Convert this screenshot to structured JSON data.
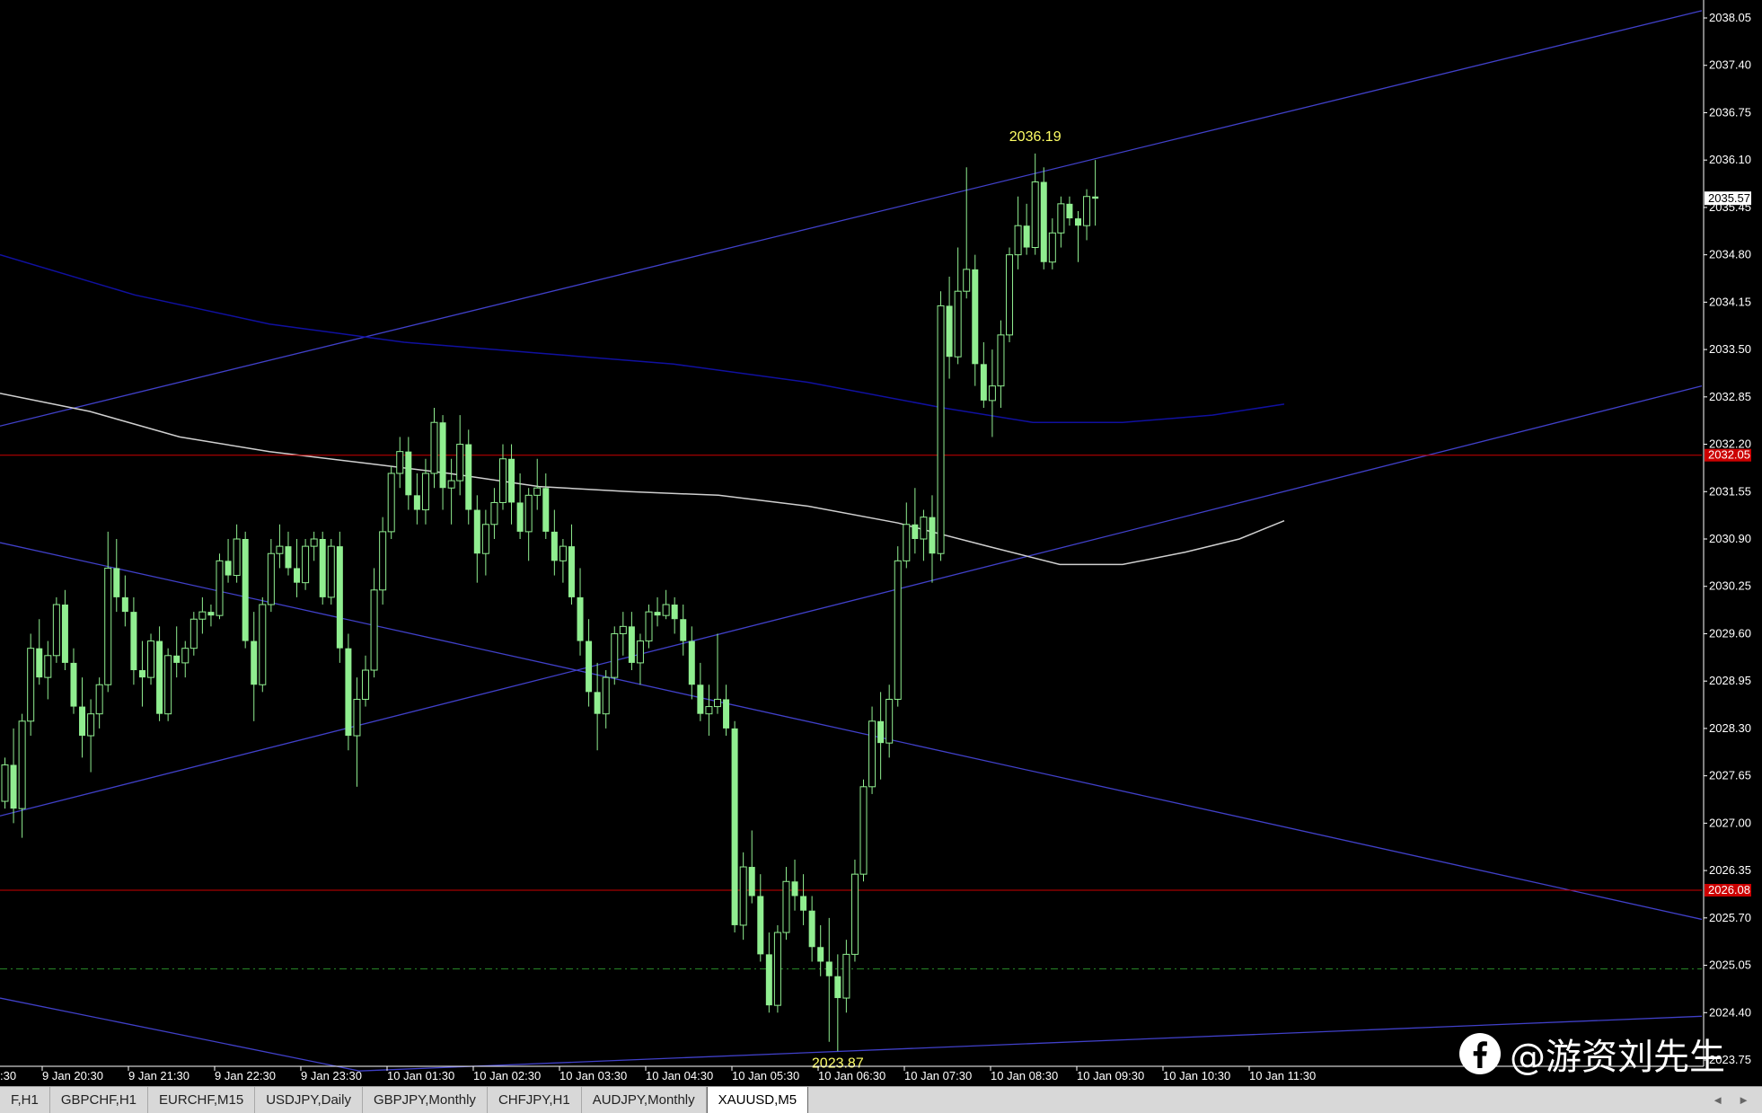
{
  "chart_data": {
    "type": "candlestick",
    "symbol": "XAUUSD",
    "timeframe": "M5",
    "y_axis": {
      "range": [
        2023.55,
        2038.2
      ],
      "tick_labels": [
        "2038.05",
        "2037.40",
        "2036.75",
        "2036.10",
        "2035.45",
        "2034.80",
        "2034.15",
        "2033.50",
        "2032.85",
        "2032.20",
        "2031.55",
        "2030.90",
        "2030.25",
        "2029.60",
        "2028.95",
        "2028.30",
        "2027.65",
        "2027.00",
        "2026.35",
        "2025.70",
        "2025.05",
        "2024.40",
        "2023.75"
      ]
    },
    "x_axis": {
      "tick_labels": [
        "9 Jan 20:30",
        "9 Jan 21:30",
        "9 Jan 22:30",
        "9 Jan 23:30",
        "10 Jan 01:30",
        "10 Jan 02:30",
        "10 Jan 03:30",
        "10 Jan 04:30",
        "10 Jan 05:30",
        "10 Jan 06:30",
        "10 Jan 07:30",
        "10 Jan 08:30",
        "10 Jan 09:30",
        "10 Jan 10:30",
        "10 Jan 11:30"
      ]
    },
    "current_price": "2035.57",
    "horizontal_levels": [
      {
        "value": 2032.05,
        "label": "2032.05",
        "color": "#cc0000"
      },
      {
        "value": 2026.08,
        "label": "2026.08",
        "color": "#cc0000"
      }
    ],
    "dashed_level": {
      "value": 2025.0,
      "color": "#2a8a2a"
    },
    "annotations": [
      {
        "text": "2036.19",
        "price": 2036.19
      },
      {
        "text": "2023.87",
        "price": 2023.87
      }
    ],
    "moving_averages": [
      {
        "color": "#1010a0",
        "points": [
          [
            0,
            2034.8
          ],
          [
            150,
            2034.25
          ],
          [
            300,
            2033.85
          ],
          [
            450,
            2033.6
          ],
          [
            600,
            2033.45
          ],
          [
            750,
            2033.3
          ],
          [
            900,
            2033.05
          ],
          [
            1050,
            2032.7
          ],
          [
            1150,
            2032.5
          ],
          [
            1250,
            2032.5
          ],
          [
            1350,
            2032.6
          ],
          [
            1430,
            2032.75
          ]
        ]
      },
      {
        "color": "#d0d0d0",
        "points": [
          [
            0,
            2032.9
          ],
          [
            100,
            2032.65
          ],
          [
            200,
            2032.3
          ],
          [
            300,
            2032.1
          ],
          [
            400,
            2031.95
          ],
          [
            500,
            2031.8
          ],
          [
            600,
            2031.62
          ],
          [
            700,
            2031.55
          ],
          [
            800,
            2031.5
          ],
          [
            900,
            2031.35
          ],
          [
            1000,
            2031.12
          ],
          [
            1100,
            2030.8
          ],
          [
            1180,
            2030.55
          ],
          [
            1250,
            2030.55
          ],
          [
            1320,
            2030.72
          ],
          [
            1380,
            2030.9
          ],
          [
            1430,
            2031.15
          ]
        ]
      }
    ],
    "trend_lines": [
      {
        "color": "#4040c8",
        "from": [
          0,
          2032.45
        ],
        "to": [
          1895,
          2038.15
        ]
      },
      {
        "color": "#4040c8",
        "from": [
          0,
          2027.1
        ],
        "to": [
          1895,
          2033.0
        ]
      },
      {
        "color": "#4040c8",
        "from": [
          0,
          2030.85
        ],
        "to": [
          1895,
          2025.68
        ]
      },
      {
        "color": "#4040c8",
        "from": [
          0,
          2024.6
        ],
        "to": [
          400,
          2023.6
        ]
      },
      {
        "color": "#4040c8",
        "from": [
          400,
          2023.6
        ],
        "to": [
          1895,
          2024.35
        ]
      }
    ],
    "candles": [
      [
        2027.3,
        2027.9,
        2027.2,
        2027.8
      ],
      [
        2027.8,
        2028.3,
        2027.0,
        2027.2
      ],
      [
        2027.2,
        2028.5,
        2026.8,
        2028.4
      ],
      [
        2028.4,
        2029.6,
        2028.2,
        2029.4
      ],
      [
        2029.4,
        2029.8,
        2028.9,
        2029.0
      ],
      [
        2029.0,
        2029.5,
        2028.7,
        2029.3
      ],
      [
        2029.3,
        2030.1,
        2029.2,
        2030.0
      ],
      [
        2030.0,
        2030.2,
        2029.1,
        2029.2
      ],
      [
        2029.2,
        2029.4,
        2028.5,
        2028.6
      ],
      [
        2028.6,
        2029.0,
        2027.9,
        2028.2
      ],
      [
        2028.2,
        2028.7,
        2027.7,
        2028.5
      ],
      [
        2028.5,
        2029.0,
        2028.3,
        2028.9
      ],
      [
        2028.9,
        2031.0,
        2028.8,
        2030.5
      ],
      [
        2030.5,
        2030.9,
        2029.9,
        2030.1
      ],
      [
        2030.1,
        2030.4,
        2029.7,
        2029.9
      ],
      [
        2029.9,
        2030.1,
        2028.9,
        2029.1
      ],
      [
        2029.1,
        2029.5,
        2028.6,
        2029.0
      ],
      [
        2029.0,
        2029.6,
        2028.9,
        2029.5
      ],
      [
        2029.5,
        2029.7,
        2028.4,
        2028.5
      ],
      [
        2028.5,
        2029.4,
        2028.4,
        2029.3
      ],
      [
        2029.3,
        2029.7,
        2029.0,
        2029.2
      ],
      [
        2029.2,
        2029.5,
        2029.0,
        2029.4
      ],
      [
        2029.4,
        2029.9,
        2029.3,
        2029.8
      ],
      [
        2029.8,
        2030.1,
        2029.6,
        2029.9
      ],
      [
        2029.9,
        2030.0,
        2029.7,
        2029.85
      ],
      [
        2029.85,
        2030.7,
        2029.8,
        2030.6
      ],
      [
        2030.6,
        2030.9,
        2030.3,
        2030.4
      ],
      [
        2030.4,
        2031.1,
        2030.3,
        2030.9
      ],
      [
        2030.9,
        2031.0,
        2029.4,
        2029.5
      ],
      [
        2029.5,
        2029.9,
        2028.4,
        2028.9
      ],
      [
        2028.9,
        2030.1,
        2028.8,
        2030.0
      ],
      [
        2030.0,
        2030.9,
        2029.9,
        2030.7
      ],
      [
        2030.7,
        2031.1,
        2030.5,
        2030.8
      ],
      [
        2030.8,
        2031.0,
        2030.4,
        2030.5
      ],
      [
        2030.5,
        2030.9,
        2030.1,
        2030.3
      ],
      [
        2030.3,
        2030.9,
        2030.2,
        2030.8
      ],
      [
        2030.8,
        2031.0,
        2030.6,
        2030.9
      ],
      [
        2030.9,
        2031.0,
        2030.0,
        2030.1
      ],
      [
        2030.1,
        2030.9,
        2030.0,
        2030.8
      ],
      [
        2030.8,
        2031.0,
        2029.2,
        2029.4
      ],
      [
        2029.4,
        2029.6,
        2028.0,
        2028.2
      ],
      [
        2028.2,
        2029.0,
        2027.5,
        2028.7
      ],
      [
        2028.7,
        2029.3,
        2028.6,
        2029.1
      ],
      [
        2029.1,
        2030.5,
        2029.0,
        2030.2
      ],
      [
        2030.2,
        2031.2,
        2030.0,
        2031.0
      ],
      [
        2031.0,
        2031.9,
        2030.9,
        2031.8
      ],
      [
        2031.8,
        2032.3,
        2031.6,
        2032.1
      ],
      [
        2032.1,
        2032.3,
        2031.3,
        2031.5
      ],
      [
        2031.5,
        2031.8,
        2031.1,
        2031.3
      ],
      [
        2031.3,
        2032.0,
        2031.1,
        2031.8
      ],
      [
        2031.8,
        2032.7,
        2031.6,
        2032.5
      ],
      [
        2032.5,
        2032.6,
        2031.3,
        2031.6
      ],
      [
        2031.6,
        2032.0,
        2031.1,
        2031.7
      ],
      [
        2031.7,
        2032.6,
        2031.5,
        2032.2
      ],
      [
        2032.2,
        2032.4,
        2031.1,
        2031.3
      ],
      [
        2031.3,
        2031.5,
        2030.3,
        2030.7
      ],
      [
        2030.7,
        2031.3,
        2030.4,
        2031.1
      ],
      [
        2031.1,
        2031.6,
        2030.9,
        2031.4
      ],
      [
        2031.4,
        2032.2,
        2031.3,
        2032.0
      ],
      [
        2032.0,
        2032.2,
        2031.1,
        2031.4
      ],
      [
        2031.4,
        2031.8,
        2030.9,
        2031.0
      ],
      [
        2031.0,
        2031.6,
        2030.6,
        2031.5
      ],
      [
        2031.5,
        2032.0,
        2031.3,
        2031.6
      ],
      [
        2031.6,
        2031.8,
        2030.9,
        2031.0
      ],
      [
        2031.0,
        2031.3,
        2030.4,
        2030.6
      ],
      [
        2030.6,
        2030.9,
        2030.3,
        2030.8
      ],
      [
        2030.8,
        2031.1,
        2030.0,
        2030.1
      ],
      [
        2030.1,
        2030.5,
        2029.3,
        2029.5
      ],
      [
        2029.5,
        2029.8,
        2028.6,
        2028.8
      ],
      [
        2028.8,
        2029.2,
        2028.0,
        2028.5
      ],
      [
        2028.5,
        2029.1,
        2028.3,
        2029.0
      ],
      [
        2029.0,
        2029.7,
        2028.9,
        2029.6
      ],
      [
        2029.6,
        2029.9,
        2029.3,
        2029.7
      ],
      [
        2029.7,
        2029.9,
        2029.1,
        2029.2
      ],
      [
        2029.2,
        2029.6,
        2028.9,
        2029.5
      ],
      [
        2029.5,
        2030.0,
        2029.4,
        2029.9
      ],
      [
        2029.9,
        2030.1,
        2029.7,
        2029.85
      ],
      [
        2029.85,
        2030.2,
        2029.8,
        2030.0
      ],
      [
        2030.0,
        2030.1,
        2029.6,
        2029.8
      ],
      [
        2029.8,
        2030.0,
        2029.3,
        2029.5
      ],
      [
        2029.5,
        2029.7,
        2028.7,
        2028.9
      ],
      [
        2028.9,
        2029.2,
        2028.4,
        2028.5
      ],
      [
        2028.5,
        2028.9,
        2028.2,
        2028.6
      ],
      [
        2028.6,
        2029.6,
        2028.5,
        2028.7
      ],
      [
        2028.7,
        2028.9,
        2028.2,
        2028.3
      ],
      [
        2028.3,
        2028.4,
        2025.5,
        2025.6
      ],
      [
        2025.6,
        2026.6,
        2025.4,
        2026.4
      ],
      [
        2026.4,
        2026.9,
        2025.9,
        2026.0
      ],
      [
        2026.0,
        2026.3,
        2025.1,
        2025.2
      ],
      [
        2025.2,
        2025.5,
        2024.4,
        2024.5
      ],
      [
        2024.5,
        2025.6,
        2024.4,
        2025.5
      ],
      [
        2025.5,
        2026.4,
        2025.4,
        2026.2
      ],
      [
        2026.2,
        2026.5,
        2025.8,
        2026.0
      ],
      [
        2026.0,
        2026.3,
        2025.6,
        2025.8
      ],
      [
        2025.8,
        2026.0,
        2025.1,
        2025.3
      ],
      [
        2025.3,
        2025.6,
        2024.9,
        2025.1
      ],
      [
        2025.1,
        2025.7,
        2024.0,
        2024.9
      ],
      [
        2024.9,
        2025.2,
        2023.87,
        2024.6
      ],
      [
        2024.6,
        2025.4,
        2024.4,
        2025.2
      ],
      [
        2025.2,
        2026.5,
        2025.1,
        2026.3
      ],
      [
        2026.3,
        2027.6,
        2026.2,
        2027.5
      ],
      [
        2027.5,
        2028.6,
        2027.4,
        2028.4
      ],
      [
        2028.4,
        2028.8,
        2027.6,
        2028.1
      ],
      [
        2028.1,
        2028.9,
        2027.9,
        2028.7
      ],
      [
        2028.7,
        2030.8,
        2028.6,
        2030.6
      ],
      [
        2030.6,
        2031.4,
        2030.5,
        2031.1
      ],
      [
        2031.1,
        2031.6,
        2030.7,
        2030.9
      ],
      [
        2030.9,
        2031.3,
        2030.6,
        2031.2
      ],
      [
        2031.2,
        2031.5,
        2030.3,
        2030.7
      ],
      [
        2030.7,
        2034.3,
        2030.6,
        2034.1
      ],
      [
        2034.1,
        2034.5,
        2033.1,
        2033.4
      ],
      [
        2033.4,
        2034.9,
        2033.3,
        2034.3
      ],
      [
        2034.3,
        2036.0,
        2034.2,
        2034.6
      ],
      [
        2034.6,
        2034.8,
        2033.0,
        2033.3
      ],
      [
        2033.3,
        2033.6,
        2032.7,
        2032.8
      ],
      [
        2032.8,
        2033.5,
        2032.3,
        2033.0
      ],
      [
        2033.0,
        2033.9,
        2032.7,
        2033.7
      ],
      [
        2033.7,
        2034.9,
        2033.6,
        2034.8
      ],
      [
        2034.8,
        2035.6,
        2034.6,
        2035.2
      ],
      [
        2035.2,
        2035.5,
        2034.8,
        2034.9
      ],
      [
        2034.9,
        2036.19,
        2034.8,
        2035.8
      ],
      [
        2035.8,
        2036.0,
        2034.6,
        2034.7
      ],
      [
        2034.7,
        2035.3,
        2034.6,
        2035.1
      ],
      [
        2035.1,
        2035.6,
        2034.9,
        2035.5
      ],
      [
        2035.5,
        2035.6,
        2035.2,
        2035.3
      ],
      [
        2035.3,
        2035.4,
        2034.7,
        2035.2
      ],
      [
        2035.2,
        2035.7,
        2035.0,
        2035.6
      ],
      [
        2035.6,
        2036.1,
        2035.2,
        2035.57
      ]
    ]
  },
  "tabs": [
    {
      "label": "F,H1",
      "active": false
    },
    {
      "label": "GBPCHF,H1",
      "active": false
    },
    {
      "label": "EURCHF,M15",
      "active": false
    },
    {
      "label": "USDJPY,Daily",
      "active": false
    },
    {
      "label": "GBPJPY,Monthly",
      "active": false
    },
    {
      "label": "CHFJPY,H1",
      "active": false
    },
    {
      "label": "AUDJPY,Monthly",
      "active": false
    },
    {
      "label": "XAUUSD,M5",
      "active": true
    }
  ],
  "tab_arrows": {
    "left": "◄",
    "right": "►"
  },
  "watermark": {
    "text": "@游资刘先生",
    "icon": "facebook-icon"
  },
  "colors": {
    "background": "#000000",
    "candle": "#90ee90",
    "axis": "#ffffff",
    "level": "#cc0000",
    "tab_bar": "#d8d8d8"
  }
}
